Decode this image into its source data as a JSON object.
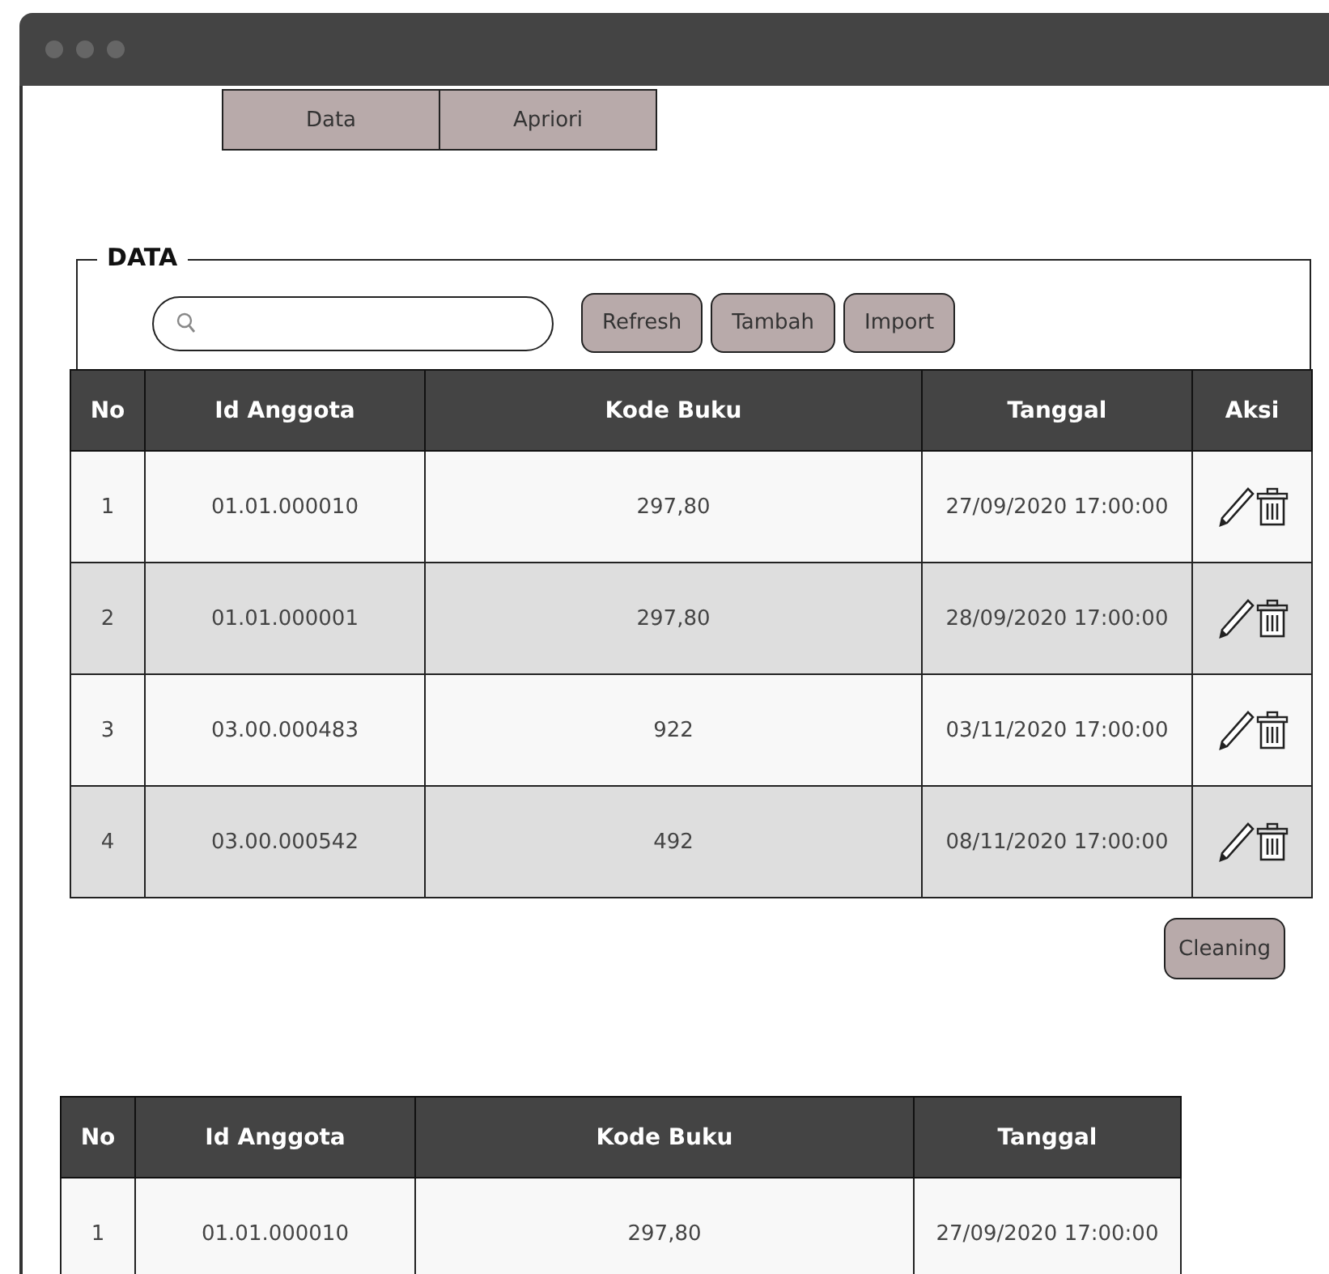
{
  "tabs": [
    {
      "label": "Data",
      "selected": false
    },
    {
      "label": "Apriori",
      "selected": false
    }
  ],
  "data_section": {
    "legend": "DATA",
    "buttons": [
      "Refresh",
      "Tambah",
      "Import"
    ]
  },
  "table": {
    "columns": [
      "No",
      "Id Anggota",
      "Kode Buku",
      "Tanggal",
      "Aksi"
    ],
    "rows": [
      {
        "no": "1",
        "id_anggota": "01.01.000010",
        "kode_buku": "297,80",
        "tanggal": "27/09/2020 17:00:00"
      },
      {
        "no": "2",
        "id_anggota": "01.01.000001",
        "kode_buku": "297,80",
        "tanggal": "28/09/2020 17:00:00"
      },
      {
        "no": "3",
        "id_anggota": "03.00.000483",
        "kode_buku": "922",
        "tanggal": "03/11/2020 17:00:00"
      },
      {
        "no": "4",
        "id_anggota": "03.00.000542",
        "kode_buku": "492",
        "tanggal": "08/11/2020 17:00:00"
      }
    ]
  },
  "cleaning_button": "Cleaning",
  "result_table": {
    "columns": [
      "No",
      "Id Anggota",
      "Kode Buku",
      "Tanggal"
    ],
    "rows": [
      {
        "no": "1",
        "id_anggota": "01.01.000010",
        "kode_buku": "297,80",
        "tanggal": "27/09/2020 17:00:00"
      }
    ]
  }
}
